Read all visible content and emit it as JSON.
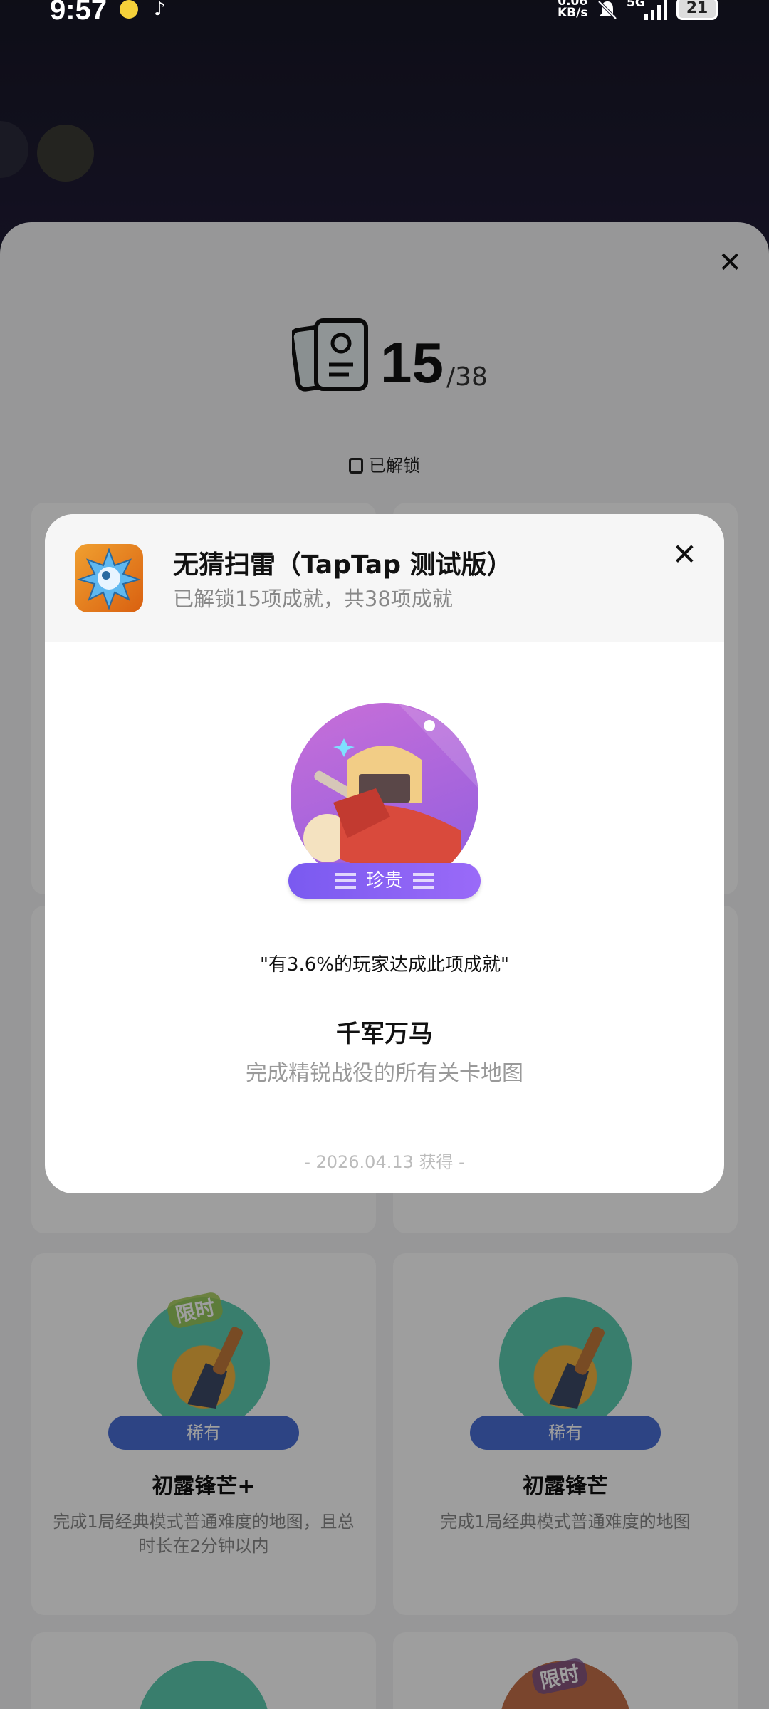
{
  "status_bar": {
    "time": "9:57",
    "net_speed": "0.06\nKB/s",
    "network": "5G",
    "battery": "21"
  },
  "sheet": {
    "unlocked_count": "15",
    "total_count": "/38",
    "unlocked_label": "已解锁"
  },
  "cards": [
    {
      "title": "初露锋芒+",
      "desc": "完成1局经典模式普通难度的地图，且总时长在2分钟以内",
      "rarity": "稀有",
      "tag": "限时"
    },
    {
      "title": "初露锋芒",
      "desc": "完成1局经典模式普通难度的地图",
      "rarity": "稀有"
    },
    {
      "tag": "限时"
    }
  ],
  "modal": {
    "game_title": "无猜扫雷（TapTap 测试版）",
    "subtitle": "已解锁15项成就，共38项成就",
    "rarity": "珍贵",
    "percent_text": "\"有3.6%的玩家达成此项成就\"",
    "name": "千军万马",
    "desc": "完成精锐战役的所有关卡地图",
    "date": "- 2026.04.13 获得 -"
  },
  "colors": {
    "rare_pill": "#4a6fd6",
    "precious_pill": "#7a5af0",
    "sheet_bg": "#f4f4f6"
  }
}
